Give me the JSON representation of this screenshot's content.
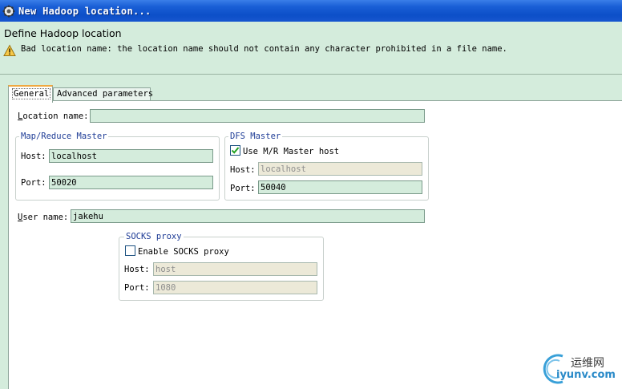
{
  "window": {
    "title": "New Hadoop location..."
  },
  "banner": {
    "title": "Define Hadoop location",
    "message": "Bad location name: the location name should not contain any character prohibited in a file name."
  },
  "tabs": [
    {
      "label": "General",
      "active": true
    },
    {
      "label": "Advanced parameters",
      "active": false
    }
  ],
  "general": {
    "location_name": {
      "label_prefix": "L",
      "label_rest": "ocation name:",
      "value": ""
    },
    "mapreduce_master": {
      "title": "Map/Reduce Master",
      "host_label": "Host:",
      "host_value": "localhost",
      "port_label": "Port:",
      "port_value": "50020"
    },
    "dfs_master": {
      "title": "DFS Master",
      "use_mr_label": "Use M/R Master host",
      "use_mr_checked": true,
      "host_label": "Host:",
      "host_value": "localhost",
      "port_label": "Port:",
      "port_value": "50040"
    },
    "user_name": {
      "label_prefix": "U",
      "label_rest": "ser name:",
      "value": "jakehu"
    },
    "socks_proxy": {
      "title": "SOCKS proxy",
      "enable_label": "Enable SOCKS proxy",
      "enable_checked": false,
      "host_label": "Host:",
      "host_value": "host",
      "port_label": "Port:",
      "port_value": "1080"
    }
  },
  "watermark": {
    "cn": "运维网",
    "en": "iyunv.com"
  },
  "colors": {
    "titlebar": "#0c4fc8",
    "banner_bg": "#d4ecdc",
    "field_bg": "#d4ecdc",
    "disabled_bg": "#ece9d8",
    "group_title": "#1e3c96",
    "tab_highlight": "#f0a840"
  }
}
